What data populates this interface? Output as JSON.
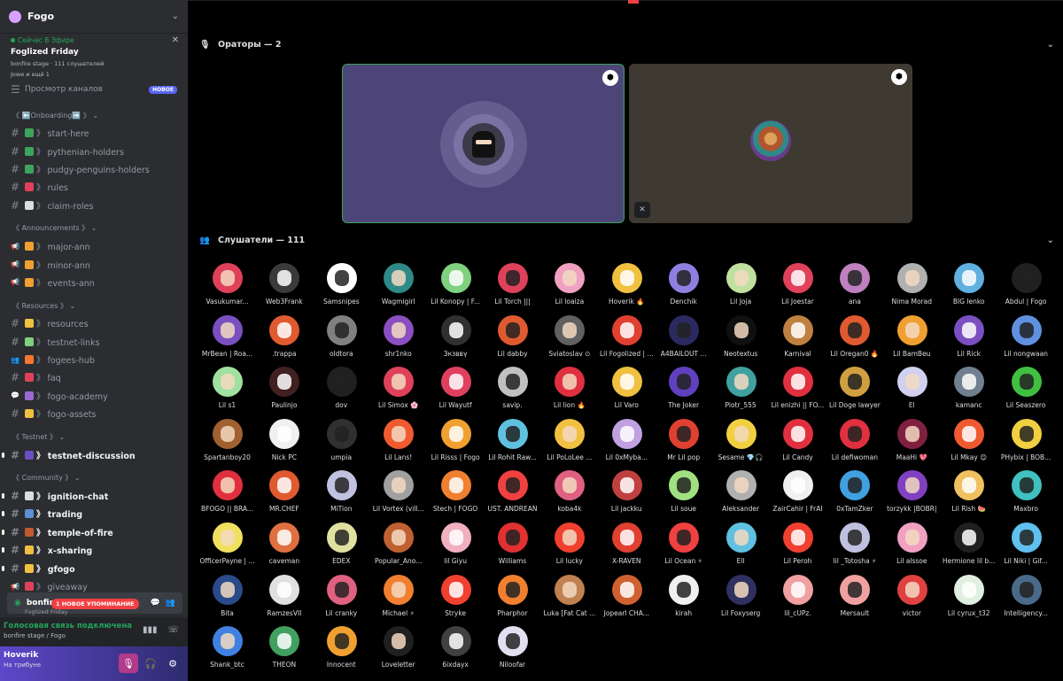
{
  "server": {
    "name": "Fogo"
  },
  "stage_card": {
    "live_label": "Сейчас В Эфире",
    "title": "Foglized Friday",
    "line1": "bonfire stage · 111 слушателей",
    "line2": "Jowe и ещё 1"
  },
  "browse": {
    "label": "Просмотр каналов",
    "badge": "НОВОЕ"
  },
  "categories": [
    {
      "label": "《 ⬅️Onboarding➡️ 》",
      "channels": [
        {
          "name": "start-here",
          "icon": "hash",
          "emoji_color": "#3ba55d"
        },
        {
          "name": "pythenian-holders",
          "icon": "hash",
          "emoji_color": "#3ba55d"
        },
        {
          "name": "pudgy-penguins-holders",
          "icon": "hash",
          "emoji_color": "#3ba55d"
        },
        {
          "name": "rules",
          "icon": "hash",
          "emoji_color": "#e0415a"
        },
        {
          "name": "claim-roles",
          "icon": "hash",
          "emoji_color": "#dbdee1"
        }
      ]
    },
    {
      "label": "《 Announcements 》",
      "channels": [
        {
          "name": "major-ann",
          "icon": "megaphone",
          "emoji_color": "#f0a030"
        },
        {
          "name": "minor-ann",
          "icon": "megaphone",
          "emoji_color": "#f0a030"
        },
        {
          "name": "events-ann",
          "icon": "megaphone",
          "emoji_color": "#f0a030"
        }
      ]
    },
    {
      "label": "《 Resources 》",
      "channels": [
        {
          "name": "resources",
          "icon": "hash",
          "emoji_color": "#f0c040"
        },
        {
          "name": "testnet-links",
          "icon": "hash",
          "emoji_color": "#7fd17f"
        },
        {
          "name": "fogees-hub",
          "icon": "people",
          "emoji_color": "#f57731"
        },
        {
          "name": "faq",
          "icon": "hash",
          "emoji_color": "#e0415a"
        },
        {
          "name": "fogo-academy",
          "icon": "forum",
          "emoji_color": "#9a6ad0"
        },
        {
          "name": "fogo-assets",
          "icon": "hash",
          "emoji_color": "#f0c040"
        }
      ]
    },
    {
      "label": "《 Testnet 》",
      "channels": [
        {
          "name": "testnet-discussion",
          "icon": "hash",
          "emoji_color": "#6a4fc0",
          "unread": true
        }
      ]
    },
    {
      "label": "《 Community 》",
      "channels": [
        {
          "name": "ignition-chat",
          "icon": "hash",
          "emoji_color": "#dbdee1",
          "unread": true
        },
        {
          "name": "trading",
          "icon": "hash",
          "emoji_color": "#5b8fd6",
          "unread": true
        },
        {
          "name": "temple-of-fire",
          "icon": "hash",
          "emoji_color": "#c05a30",
          "unread": true
        },
        {
          "name": "x-sharing",
          "icon": "hash",
          "emoji_color": "#f0c040",
          "unread": true
        },
        {
          "name": "gfogo",
          "icon": "hash",
          "emoji_color": "#f0c040",
          "unread": true
        },
        {
          "name": "giveaway",
          "icon": "megaphone",
          "emoji_color": "#e0415a"
        }
      ]
    }
  ],
  "voice_row": {
    "name": "bonfire stage",
    "mention": "1 НОВОЕ УПОМИНАНИЕ",
    "sub": "Foglized Friday"
  },
  "connection": {
    "status": "Голосовая связь подключена",
    "location": "bonfire stage / Fogo"
  },
  "user": {
    "name": "Hoverik",
    "status": "На трибуне"
  },
  "speakers_header": "Ораторы — 2",
  "listeners_header": "Слушатели — 111",
  "listeners": [
    "Vasukumar...",
    "Web3Frank",
    "Samsnipes",
    "Wagmigirl",
    "Lil Konopy | F...",
    "Lil Torch |||",
    "Lil loaiza",
    "Hoverik 🔥",
    "Denchik",
    "Lil Joja",
    "Lil Joestar",
    "ana",
    "Nima Morad",
    "BIG lenko",
    "Abdul | Fogo",
    "MrBean | Roa...",
    ".trappa",
    "oldtora",
    "shr1nko",
    "Зкзввү",
    "Lil dabby",
    "Sviatoslav ⊙",
    "Lil Fogolized | ...",
    "A4BAILOUT ...",
    "Neotextus",
    "Karnival",
    "Lil Oregan0 🔥",
    "Lil BamBeu",
    "Lil Rick",
    "Lil nongwaan",
    "Lil s1",
    "Paulinjo",
    "dov",
    "Lil Simox 🌸",
    "Lil Wayutf",
    "savip.",
    "Lil lion 🔥",
    "Lil Varo",
    "The Joker",
    "Piotr_555",
    "Lil enizhi || FO...",
    "Lil Doge lawyer",
    "El",
    "kamanc",
    "Lil Seaszero",
    "Spartanboy20",
    "Nick PC",
    "umpia",
    "Lil Lans!",
    "Lil Risss | Fogo",
    "Lil Rohit Raw...",
    "Lil PoLoLee ...",
    "Lil 0xMyba...",
    "Mr Lil pop",
    "Sesame 💎🎧",
    "Lil Candy",
    "Lil defiwoman",
    "MaaHi 💖",
    "Lil Mkay 😊",
    "PHybix | BOB...",
    "BFOGO || BRA...",
    "MR.CHEF",
    "MiTion",
    "Lil Vortex (vill...",
    "Stech | FOGO",
    "UST. ANDREAN",
    "koba4k",
    "Lil jackku",
    "Lil soue",
    "Aleksander",
    "ZairCahir | FrAI",
    "0xTamZker",
    "torzykk |BOBR|",
    "Lil Rish 🍉",
    "Maxbro",
    "OfficerPayne | ...",
    "caveman",
    "EDEX",
    "Popular_Ano...",
    "lil Giyu",
    "Williams",
    "Lil lucky",
    "X-RAVEN",
    "Lil Ocean ⚡",
    "Ell",
    "Lil Peroh",
    "lil _Totosha ⚡",
    "Lil alssoe",
    "Hermione lil b...",
    "Lil Niki | Gif...",
    "Bita",
    "RamzesVII",
    "Lil cranky",
    "Michael ⚡",
    "Stryke",
    "Pharphor",
    "Luka [Fat Cat ...",
    "Jopearl CHA...",
    "kirah",
    "Lil Foxyserg",
    "lil_cUPz.",
    "Mersault",
    "victor",
    "Lil cyrux_t32",
    "Intelligency...",
    "Shank_btc",
    "THEON",
    "Innocent",
    "Loveletter",
    "6ixdayx",
    "Niloofar"
  ],
  "avatar_colors": [
    "#e0415a",
    "#3a3a3a",
    "#ffffff",
    "#2e8a88",
    "#7fd17f",
    "#e0415a",
    "#f0a0c0",
    "#f0c040",
    "#8f7fe0",
    "#c0e0a0",
    "#e0415a",
    "#c080c0",
    "#b0b0b0",
    "#60b0e0",
    "#202020",
    "#7a4fc0",
    "#e05a30",
    "#808080",
    "#8a4fc0",
    "#303030",
    "#e05a30",
    "#606060",
    "#e04030",
    "#2a2a60",
    "#101010",
    "#c08040",
    "#e05a30",
    "#f0a030",
    "#7a4fc0",
    "#6090e0",
    "#a0e0a0",
    "#402020",
    "#202020",
    "#e0415a",
    "#e04060",
    "#c0c0c0",
    "#e03040",
    "#f0c040",
    "#6040c0",
    "#40a0a0",
    "#e03040",
    "#d0a040",
    "#d0d0f0",
    "#708090",
    "#40c040",
    "#a06030",
    "#f0f0f0",
    "#303030",
    "#f05a30",
    "#f0a030",
    "#60c0e0",
    "#f0c040",
    "#c0a0e0",
    "#e04030",
    "#f0d040",
    "#e03040",
    "#e03040",
    "#802040",
    "#f05a30",
    "#f0d040",
    "#e03040",
    "#e05a30",
    "#c0c0e0",
    "#a0a0a0",
    "#f08030",
    "#f04040",
    "#e06080",
    "#c04040",
    "#a0e080",
    "#b0b0b0",
    "#f0f0f0",
    "#40a0e0",
    "#8040c0",
    "#f0c060",
    "#40c0c0",
    "#f0e060",
    "#e07040",
    "#e0e0a0",
    "#c06030",
    "#f0b0c0",
    "#e03030",
    "#f04030",
    "#e04030",
    "#f04040",
    "#60c0e0",
    "#f04030",
    "#c0c0e0",
    "#f0a0c0",
    "#202020",
    "#60c0f0",
    "#2a4a8a",
    "#e0e0e0",
    "#e06080",
    "#f08030",
    "#f04030",
    "#f08030",
    "#c08050",
    "#d06030",
    "#f0f0f0",
    "#303060",
    "#f0a0a0",
    "#f0a0a0",
    "#e04040",
    "#e0f0e0",
    "#4a6a8a",
    "#4080e0",
    "#40a060",
    "#f0a030",
    "#202020",
    "#404040",
    "#e0e0f0"
  ],
  "colors": {
    "accent": "#5865f2",
    "live_green": "#23a55a",
    "speaker_ring": "#3ba55d"
  }
}
